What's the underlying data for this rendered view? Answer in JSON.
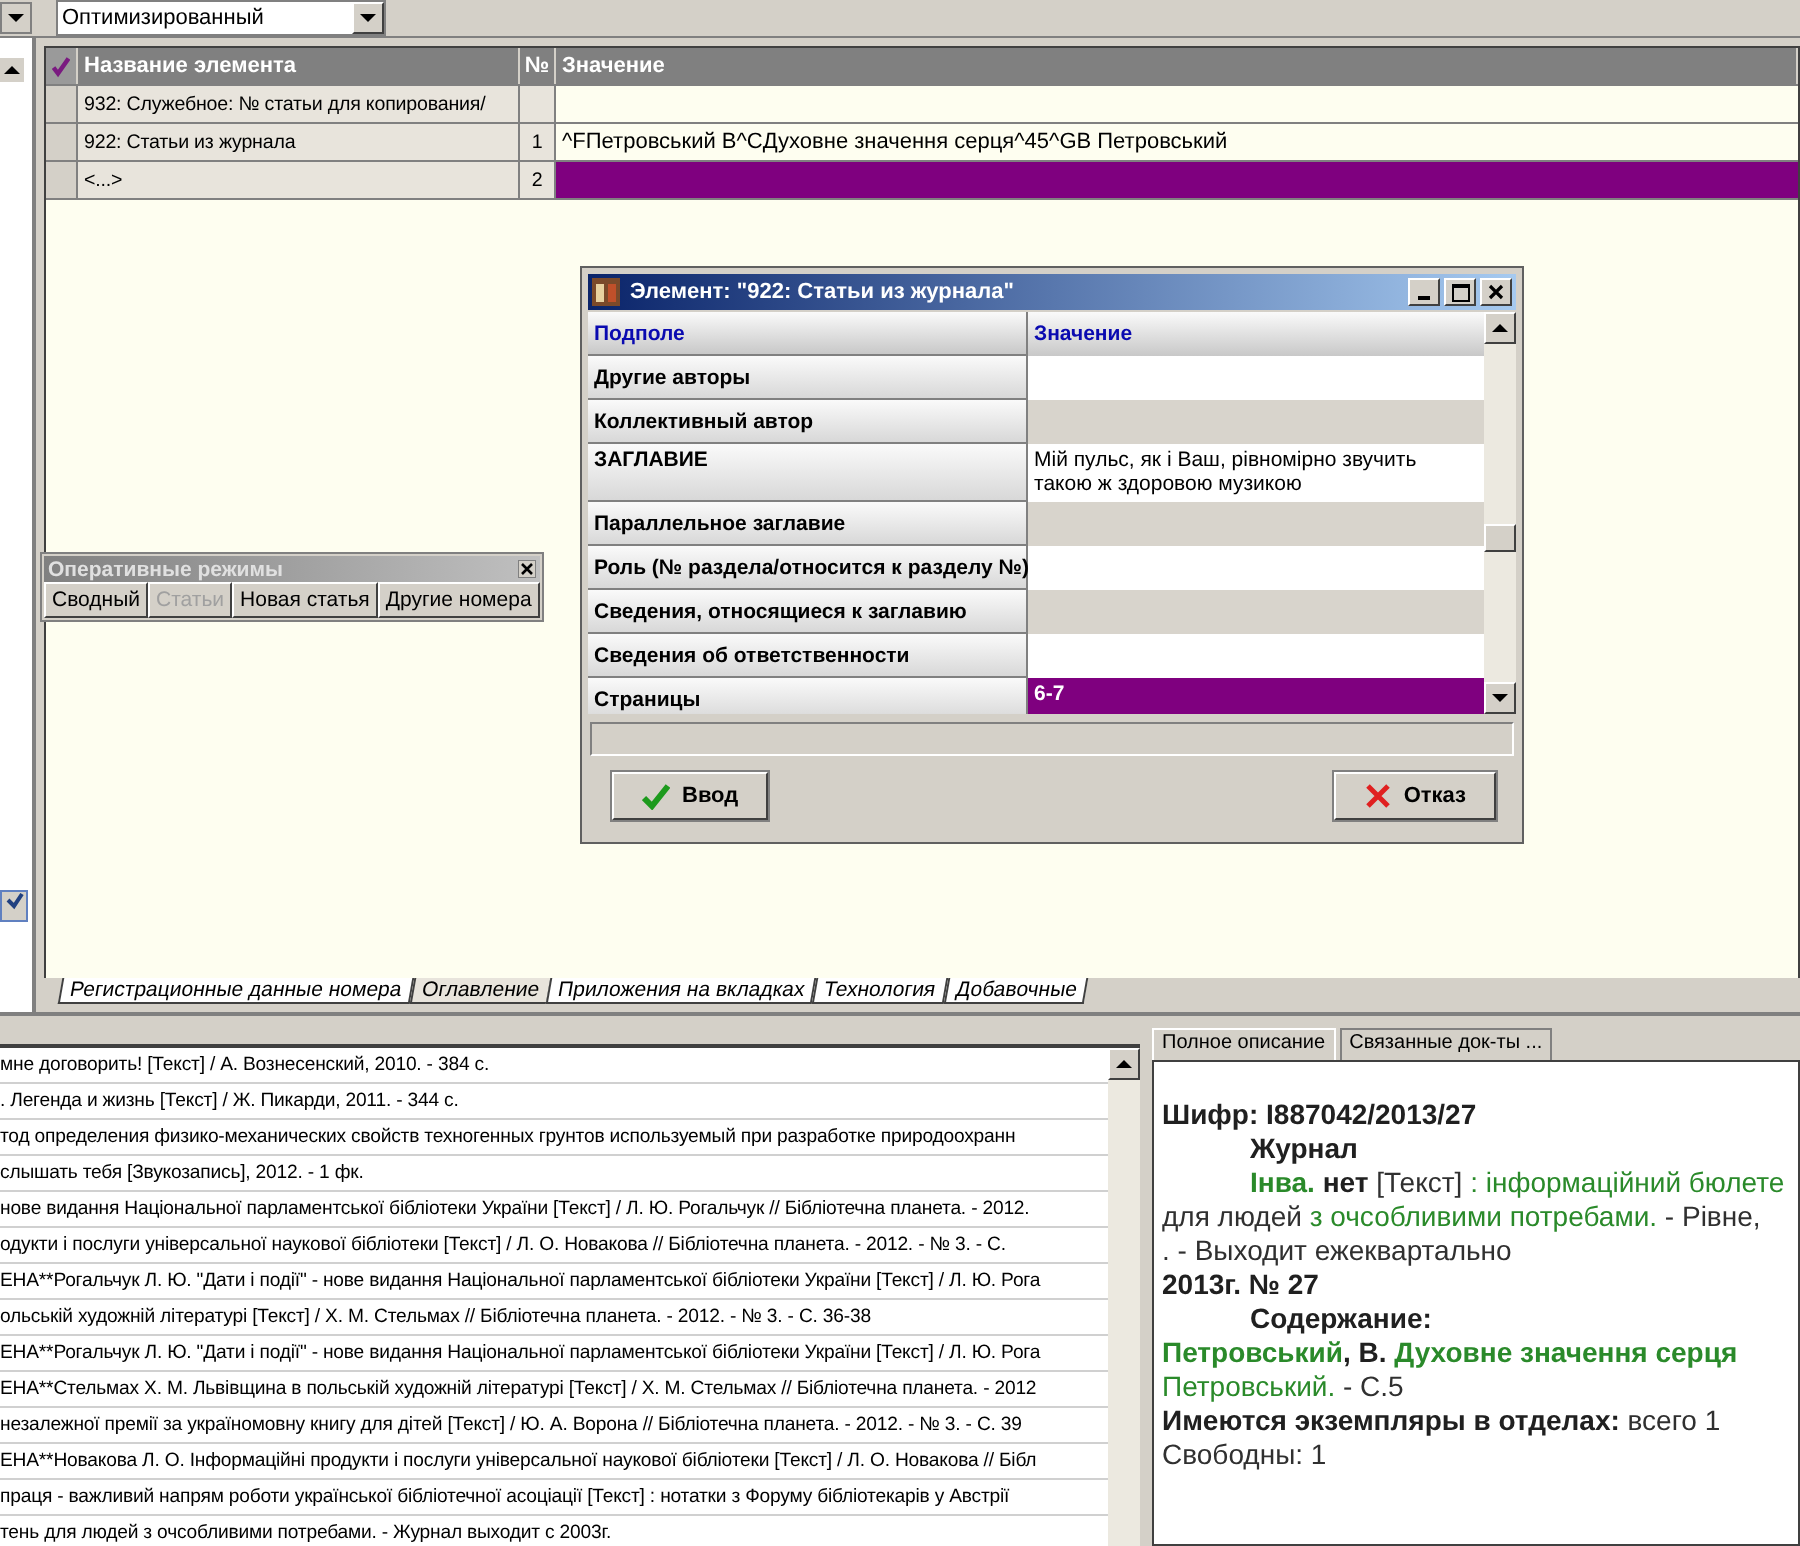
{
  "toolbar": {
    "mode_select": "Оптимизированный"
  },
  "grid": {
    "columns": [
      "Название элемента",
      "№",
      "Значение"
    ],
    "rows": [
      {
        "name": "932: Служебное: № статьи для копирования/",
        "num": "",
        "value": "",
        "selected": false
      },
      {
        "name": "922: Статьи из журнала",
        "num": "1",
        "value": "^FПетровський В^CДуховне значення серця^45^GB  Петровський",
        "selected": false
      },
      {
        "name": "<...>",
        "num": "2",
        "value": "",
        "selected": true
      }
    ]
  },
  "modes_panel": {
    "title": "Оперативные режимы",
    "buttons": [
      {
        "label": "Сводный",
        "disabled": false
      },
      {
        "label": "Статьи",
        "disabled": true
      },
      {
        "label": "Новая статья",
        "disabled": false
      },
      {
        "label": "Другие номера",
        "disabled": false
      }
    ]
  },
  "dialog": {
    "title": "Элемент: \"922: Статьи из журнала\"",
    "columns": [
      "Подполе",
      "Значение"
    ],
    "rows": [
      {
        "field": "Другие авторы",
        "value": "",
        "selected": false
      },
      {
        "field": "Коллективный автор",
        "value": "",
        "selected": false
      },
      {
        "field": "ЗАГЛАВИЕ",
        "value": "Мій пульс, як і Ваш, рівномірно звучить такою ж здоровою музикою",
        "selected": false
      },
      {
        "field": "Параллельное заглавие",
        "value": "",
        "selected": false
      },
      {
        "field": "Роль (№ раздела/относится к разделу №)",
        "value": "",
        "selected": false
      },
      {
        "field": "Сведения, относящиеся к заглавию",
        "value": "",
        "selected": false
      },
      {
        "field": "Сведения об ответственности",
        "value": "",
        "selected": false
      },
      {
        "field": "Страницы",
        "value": "6-7",
        "selected": true
      }
    ],
    "ok_button": "Ввод",
    "cancel_button": "Отказ"
  },
  "tabs": [
    {
      "label": "Регистрационные данные номера",
      "selected": false
    },
    {
      "label": "Оглавление",
      "selected": true
    },
    {
      "label": "Приложения на вкладках",
      "selected": false
    },
    {
      "label": "Технология",
      "selected": false
    },
    {
      "label": "Добавочные",
      "selected": false
    }
  ],
  "records": [
    "мне договорить! [Текст] / А. Вознесенский, 2010. - 384 с.",
    ". Легенда и жизнь [Текст] / Ж. Пикарди, 2011. - 344 с.",
    "тод определения физико-механических свойств техногенных грунтов используемый при разработке природоохранн",
    "слышать тебя [Звукозапись], 2012. - 1 фк.",
    "нове видання Національної парламентської бібліотеки України [Текст] / Л. Ю. Рогальчук // Бібліотечна планета. - 2012.",
    "одукти і послуги універсальної наукової бібліотеки [Текст] / Л. О. Новакова // Бібліотечна планета. - 2012. - № 3. -  С.",
    "ЕНА**Рогальчук Л. Ю. \"Дати і події\" - нове видання Національної парламентської бібліотеки України [Текст] / Л. Ю. Рога",
    "ольській художній літературі [Текст] / Х. М. Стельмах // Бібліотечна планета. - 2012. - № 3. -  С. 36-38",
    "ЕНА**Рогальчук Л. Ю. \"Дати і події\" - нове видання Національної парламентської бібліотеки України [Текст] / Л. Ю. Рога",
    "ЕНА**Стельмах Х. М. Львівщина в польській художній літературі [Текст] / Х. М. Стельмах // Бібліотечна планета. - 2012",
    "незалежної премії за україномовну книгу для дітей [Текст] / Ю. А. Ворона // Бібліотечна планета. - 2012. - № 3. -  С. 39",
    "ЕНА**Новакова Л. О. Інформаційні продукти і послуги універсальної наукової бібліотеки [Текст] / Л. О. Новакова // Бібл",
    "праця - важливий напрям роботи української бібліотечної асоціації [Текст] : нотатки з Форуму бібліотекарів у Австрії",
    "тень для людей з очсобливими потребами. - Журнал выходит с 2003г."
  ],
  "detail_tabs": [
    {
      "label": "Полное описание",
      "selected": true
    },
    {
      "label": "Связанные док-ты ...",
      "selected": false
    }
  ],
  "description": [
    {
      "indent": false,
      "segments": [
        {
          "kind": "bold",
          "text": "Шифр: I887042/2013/27"
        }
      ]
    },
    {
      "indent": true,
      "segments": [
        {
          "kind": "bold",
          "text": "Журнал"
        }
      ]
    },
    {
      "indent": true,
      "segments": [
        {
          "kind": "green-bold",
          "text": "Інва."
        },
        {
          "kind": "bold",
          "text": " нет"
        },
        {
          "kind": "plain",
          "text": " [Текст]"
        },
        {
          "kind": "green",
          "text": " : інформаційний бюлете"
        }
      ]
    },
    {
      "indent": false,
      "segments": [
        {
          "kind": "plain",
          "text": "для людей"
        },
        {
          "kind": "green",
          "text": " з очсобливими потребами."
        },
        {
          "kind": "plain",
          "text": " - Рівне,"
        }
      ]
    },
    {
      "indent": false,
      "segments": [
        {
          "kind": "plain",
          "text": ". - Выходит ежеквартально"
        }
      ]
    },
    {
      "indent": false,
      "segments": [
        {
          "kind": "bold",
          "text": "2013г. № 27"
        }
      ]
    },
    {
      "indent": true,
      "segments": [
        {
          "kind": "bold",
          "text": "Содержание:"
        }
      ]
    },
    {
      "indent": false,
      "segments": [
        {
          "kind": "green-bold",
          "text": "Петровський"
        },
        {
          "kind": "bold",
          "text": ", В. "
        },
        {
          "kind": "green-bold",
          "text": "Духовне значення серця"
        }
      ]
    },
    {
      "indent": false,
      "segments": [
        {
          "kind": "green",
          "text": "Петровський."
        },
        {
          "kind": "plain",
          "text": " - С.5"
        }
      ]
    },
    {
      "indent": false,
      "segments": [
        {
          "kind": "bold",
          "text": "Имеются экземпляры в отделах:"
        },
        {
          "kind": "plain",
          "text": " всего 1"
        }
      ]
    },
    {
      "indent": false,
      "segments": [
        {
          "kind": "plain",
          "text": "Свободны: 1"
        }
      ]
    }
  ]
}
